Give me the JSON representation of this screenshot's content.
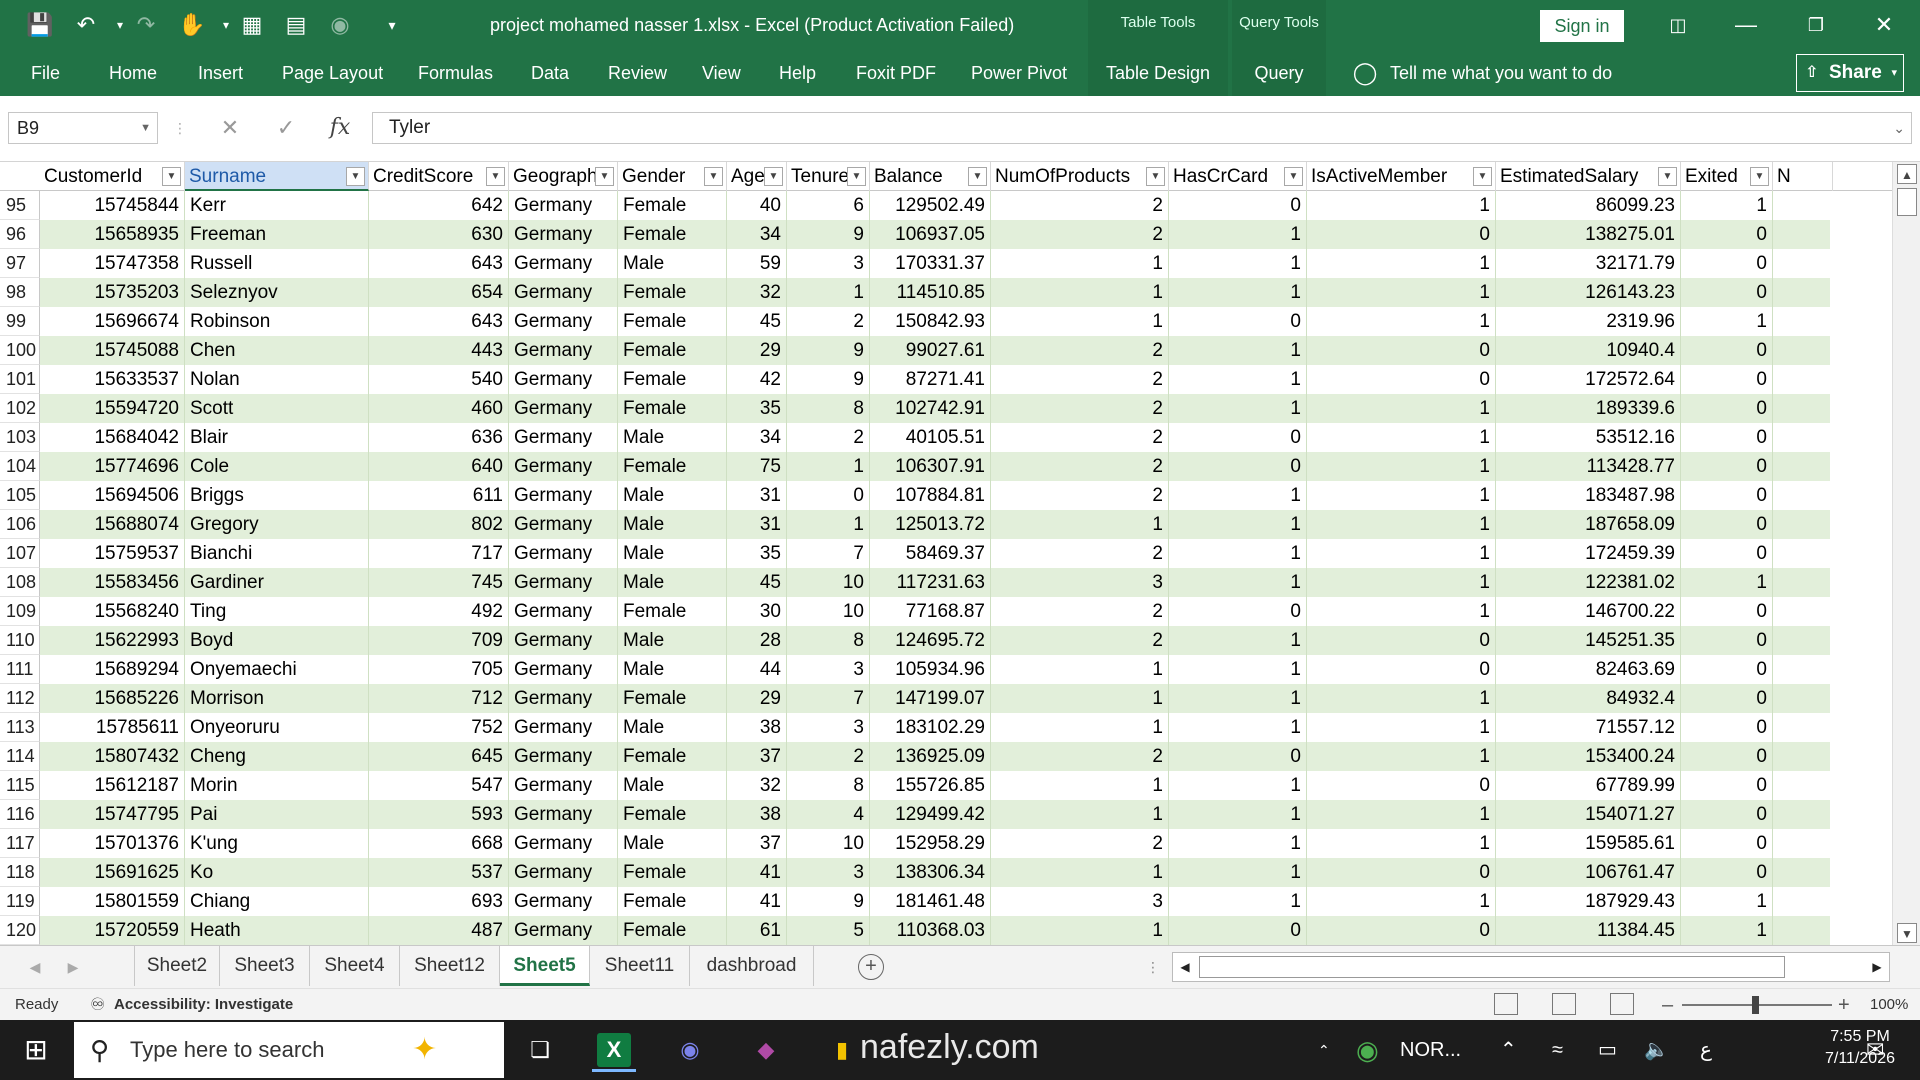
{
  "window": {
    "title": "project mohamed nasser 1.xlsx  -  Excel (Product Activation Failed)",
    "context_groups": [
      "Table Tools",
      "Query Tools"
    ],
    "sign_in": "Sign in",
    "share": "Share"
  },
  "ribbon": {
    "tabs": [
      "File",
      "Home",
      "Insert",
      "Page Layout",
      "Formulas",
      "Data",
      "Review",
      "View",
      "Help",
      "Foxit PDF",
      "Power Pivot",
      "Table Design",
      "Query"
    ],
    "tell_me": "Tell me what you want to do"
  },
  "formula_bar": {
    "name_box": "B9",
    "fx_label": "fx",
    "content": "Tyler"
  },
  "table": {
    "headers": [
      "CustomerId",
      "Surname",
      "CreditScore",
      "Geography",
      "Gender",
      "Age",
      "Tenure",
      "Balance",
      "NumOfProducts",
      "HasCrCard",
      "IsActiveMember",
      "EstimatedSalary",
      "Exited",
      "N"
    ],
    "rows": [
      {
        "n": "95",
        "v": [
          "15745844",
          "Kerr",
          "642",
          "Germany",
          "Female",
          "40",
          "6",
          "129502.49",
          "2",
          "0",
          "1",
          "86099.23",
          "1"
        ]
      },
      {
        "n": "96",
        "v": [
          "15658935",
          "Freeman",
          "630",
          "Germany",
          "Female",
          "34",
          "9",
          "106937.05",
          "2",
          "1",
          "0",
          "138275.01",
          "0"
        ]
      },
      {
        "n": "97",
        "v": [
          "15747358",
          "Russell",
          "643",
          "Germany",
          "Male",
          "59",
          "3",
          "170331.37",
          "1",
          "1",
          "1",
          "32171.79",
          "0"
        ]
      },
      {
        "n": "98",
        "v": [
          "15735203",
          "Seleznyov",
          "654",
          "Germany",
          "Female",
          "32",
          "1",
          "114510.85",
          "1",
          "1",
          "1",
          "126143.23",
          "0"
        ]
      },
      {
        "n": "99",
        "v": [
          "15696674",
          "Robinson",
          "643",
          "Germany",
          "Female",
          "45",
          "2",
          "150842.93",
          "1",
          "0",
          "1",
          "2319.96",
          "1"
        ]
      },
      {
        "n": "100",
        "v": [
          "15745088",
          "Chen",
          "443",
          "Germany",
          "Female",
          "29",
          "9",
          "99027.61",
          "2",
          "1",
          "0",
          "10940.4",
          "0"
        ]
      },
      {
        "n": "101",
        "v": [
          "15633537",
          "Nolan",
          "540",
          "Germany",
          "Female",
          "42",
          "9",
          "87271.41",
          "2",
          "1",
          "0",
          "172572.64",
          "0"
        ]
      },
      {
        "n": "102",
        "v": [
          "15594720",
          "Scott",
          "460",
          "Germany",
          "Female",
          "35",
          "8",
          "102742.91",
          "2",
          "1",
          "1",
          "189339.6",
          "0"
        ]
      },
      {
        "n": "103",
        "v": [
          "15684042",
          "Blair",
          "636",
          "Germany",
          "Male",
          "34",
          "2",
          "40105.51",
          "2",
          "0",
          "1",
          "53512.16",
          "0"
        ]
      },
      {
        "n": "104",
        "v": [
          "15774696",
          "Cole",
          "640",
          "Germany",
          "Female",
          "75",
          "1",
          "106307.91",
          "2",
          "0",
          "1",
          "113428.77",
          "0"
        ]
      },
      {
        "n": "105",
        "v": [
          "15694506",
          "Briggs",
          "611",
          "Germany",
          "Male",
          "31",
          "0",
          "107884.81",
          "2",
          "1",
          "1",
          "183487.98",
          "0"
        ]
      },
      {
        "n": "106",
        "v": [
          "15688074",
          "Gregory",
          "802",
          "Germany",
          "Male",
          "31",
          "1",
          "125013.72",
          "1",
          "1",
          "1",
          "187658.09",
          "0"
        ]
      },
      {
        "n": "107",
        "v": [
          "15759537",
          "Bianchi",
          "717",
          "Germany",
          "Male",
          "35",
          "7",
          "58469.37",
          "2",
          "1",
          "1",
          "172459.39",
          "0"
        ]
      },
      {
        "n": "108",
        "v": [
          "15583456",
          "Gardiner",
          "745",
          "Germany",
          "Male",
          "45",
          "10",
          "117231.63",
          "3",
          "1",
          "1",
          "122381.02",
          "1"
        ]
      },
      {
        "n": "109",
        "v": [
          "15568240",
          "Ting",
          "492",
          "Germany",
          "Female",
          "30",
          "10",
          "77168.87",
          "2",
          "0",
          "1",
          "146700.22",
          "0"
        ]
      },
      {
        "n": "110",
        "v": [
          "15622993",
          "Boyd",
          "709",
          "Germany",
          "Male",
          "28",
          "8",
          "124695.72",
          "2",
          "1",
          "0",
          "145251.35",
          "0"
        ]
      },
      {
        "n": "111",
        "v": [
          "15689294",
          "Onyemaechi",
          "705",
          "Germany",
          "Male",
          "44",
          "3",
          "105934.96",
          "1",
          "1",
          "0",
          "82463.69",
          "0"
        ]
      },
      {
        "n": "112",
        "v": [
          "15685226",
          "Morrison",
          "712",
          "Germany",
          "Female",
          "29",
          "7",
          "147199.07",
          "1",
          "1",
          "1",
          "84932.4",
          "0"
        ]
      },
      {
        "n": "113",
        "v": [
          "15785611",
          "Onyeoruru",
          "752",
          "Germany",
          "Male",
          "38",
          "3",
          "183102.29",
          "1",
          "1",
          "1",
          "71557.12",
          "0"
        ]
      },
      {
        "n": "114",
        "v": [
          "15807432",
          "Cheng",
          "645",
          "Germany",
          "Female",
          "37",
          "2",
          "136925.09",
          "2",
          "0",
          "1",
          "153400.24",
          "0"
        ]
      },
      {
        "n": "115",
        "v": [
          "15612187",
          "Morin",
          "547",
          "Germany",
          "Male",
          "32",
          "8",
          "155726.85",
          "1",
          "1",
          "0",
          "67789.99",
          "0"
        ]
      },
      {
        "n": "116",
        "v": [
          "15747795",
          "Pai",
          "593",
          "Germany",
          "Female",
          "38",
          "4",
          "129499.42",
          "1",
          "1",
          "1",
          "154071.27",
          "0"
        ]
      },
      {
        "n": "117",
        "v": [
          "15701376",
          "K'ung",
          "668",
          "Germany",
          "Male",
          "37",
          "10",
          "152958.29",
          "2",
          "1",
          "1",
          "159585.61",
          "0"
        ]
      },
      {
        "n": "118",
        "v": [
          "15691625",
          "Ko",
          "537",
          "Germany",
          "Female",
          "41",
          "3",
          "138306.34",
          "1",
          "1",
          "0",
          "106761.47",
          "0"
        ]
      },
      {
        "n": "119",
        "v": [
          "15801559",
          "Chiang",
          "693",
          "Germany",
          "Female",
          "41",
          "9",
          "181461.48",
          "3",
          "1",
          "1",
          "187929.43",
          "1"
        ]
      },
      {
        "n": "120",
        "v": [
          "15720559",
          "Heath",
          "487",
          "Germany",
          "Female",
          "61",
          "5",
          "110368.03",
          "1",
          "0",
          "0",
          "11384.45",
          "1"
        ]
      }
    ]
  },
  "sheets": {
    "tabs": [
      "Sheet2",
      "Sheet3",
      "Sheet4",
      "Sheet12",
      "Sheet5",
      "Sheet11",
      "dashbroad"
    ],
    "active": "Sheet5"
  },
  "status_bar": {
    "ready": "Ready",
    "accessibility": "Accessibility: Investigate",
    "zoom": "100%"
  },
  "taskbar": {
    "search_placeholder": "Type here to search",
    "watermark": "nafezly.com",
    "tray_label": "NOR...",
    "lang": "ع",
    "time": "7:55 PM",
    "date": "7/11/2026"
  },
  "colors": {
    "excel_green": "#217346",
    "banded_row": "#e2efda"
  }
}
